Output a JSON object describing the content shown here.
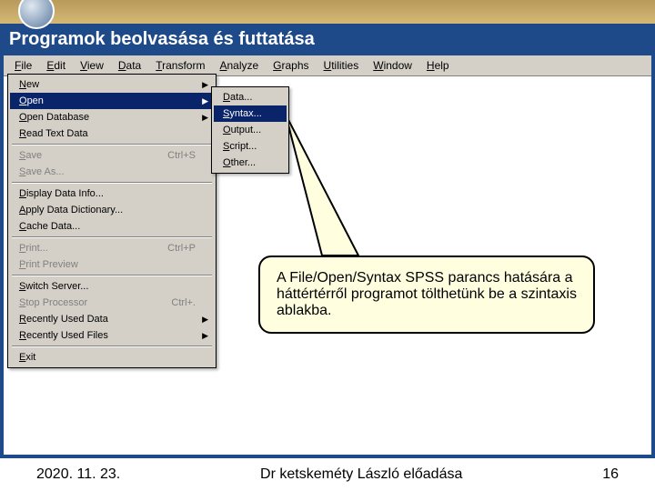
{
  "slide": {
    "title": "Programok beolvasása és futtatása"
  },
  "menubar": {
    "items": [
      "File",
      "Edit",
      "View",
      "Data",
      "Transform",
      "Analyze",
      "Graphs",
      "Utilities",
      "Window",
      "Help"
    ]
  },
  "file_menu": {
    "items": [
      {
        "label": "New",
        "shortcut": "",
        "arrow": true,
        "disabled": false
      },
      {
        "label": "Open",
        "shortcut": "",
        "arrow": true,
        "disabled": false,
        "highlighted": true
      },
      {
        "label": "Open Database",
        "shortcut": "",
        "arrow": true,
        "disabled": false
      },
      {
        "label": "Read Text Data",
        "shortcut": "",
        "arrow": false,
        "disabled": false
      },
      {
        "sep": true
      },
      {
        "label": "Save",
        "shortcut": "Ctrl+S",
        "arrow": false,
        "disabled": true
      },
      {
        "label": "Save As...",
        "shortcut": "",
        "arrow": false,
        "disabled": true
      },
      {
        "sep": true
      },
      {
        "label": "Display Data Info...",
        "shortcut": "",
        "arrow": false,
        "disabled": false
      },
      {
        "label": "Apply Data Dictionary...",
        "shortcut": "",
        "arrow": false,
        "disabled": false
      },
      {
        "label": "Cache Data...",
        "shortcut": "",
        "arrow": false,
        "disabled": false
      },
      {
        "sep": true
      },
      {
        "label": "Print...",
        "shortcut": "Ctrl+P",
        "arrow": false,
        "disabled": true
      },
      {
        "label": "Print Preview",
        "shortcut": "",
        "arrow": false,
        "disabled": true
      },
      {
        "sep": true
      },
      {
        "label": "Switch Server...",
        "shortcut": "",
        "arrow": false,
        "disabled": false
      },
      {
        "label": "Stop Processor",
        "shortcut": "Ctrl+.",
        "arrow": false,
        "disabled": true
      },
      {
        "label": "Recently Used Data",
        "shortcut": "",
        "arrow": true,
        "disabled": false
      },
      {
        "label": "Recently Used Files",
        "shortcut": "",
        "arrow": true,
        "disabled": false
      },
      {
        "sep": true
      },
      {
        "label": "Exit",
        "shortcut": "",
        "arrow": false,
        "disabled": false
      }
    ]
  },
  "open_submenu": {
    "items": [
      {
        "label": "Data..."
      },
      {
        "label": "Syntax...",
        "highlighted": true
      },
      {
        "label": "Output..."
      },
      {
        "label": "Script..."
      },
      {
        "label": "Other..."
      }
    ]
  },
  "callout": {
    "text": "A File/Open/Syntax SPSS parancs hatására a háttértérről programot tölthetünk be a szintaxis ablakba."
  },
  "footer": {
    "date": "2020. 11. 23.",
    "presenter": "Dr ketskeméty László előadása",
    "page": "16"
  }
}
